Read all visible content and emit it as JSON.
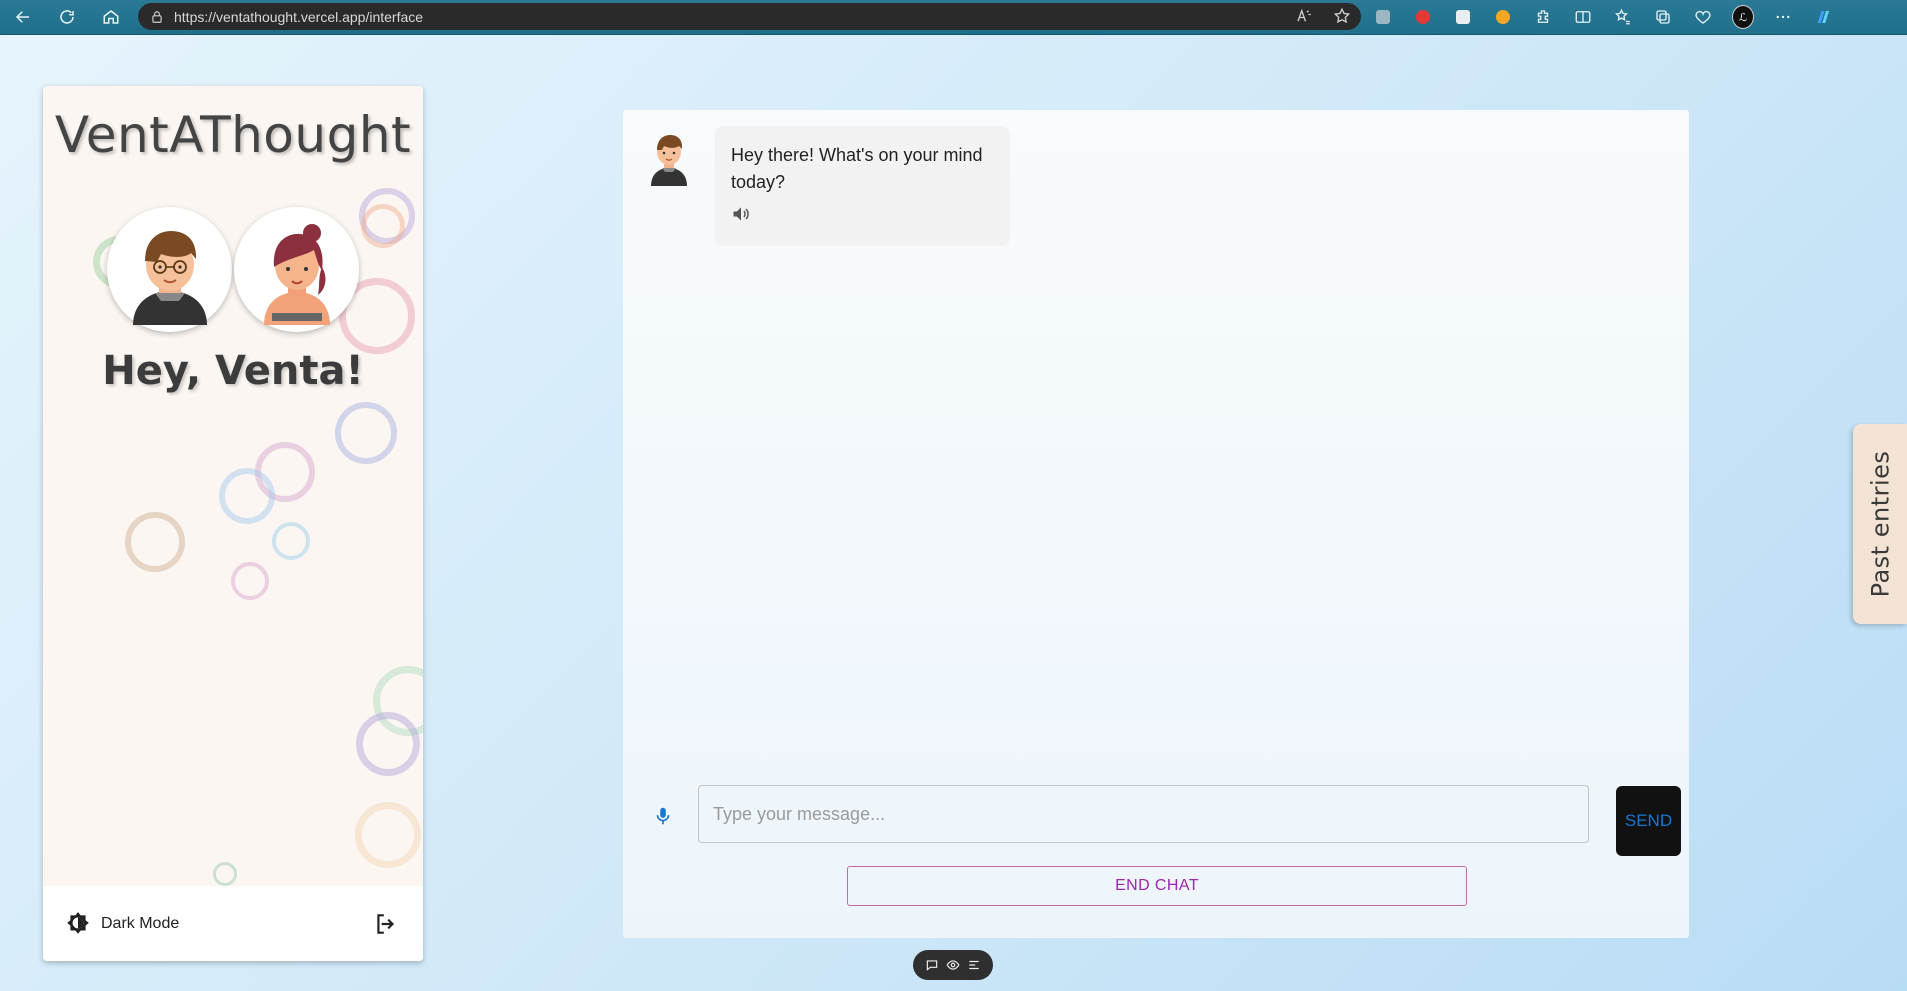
{
  "browser": {
    "url": "https://ventathought.vercel.app/interface",
    "profile_initial": "ℒ"
  },
  "sidebar": {
    "app_title": "VentAThought",
    "greeting": "Hey, Venta!",
    "dark_mode_label": "Dark Mode",
    "avatars": [
      "boy-avatar",
      "girl-avatar"
    ]
  },
  "chat": {
    "messages": [
      {
        "sender": "bot",
        "text": "Hey there! What's on your mind today?"
      }
    ],
    "input": {
      "placeholder": "Type your message...",
      "value": ""
    },
    "send_label": "SEND",
    "end_chat_label": "END CHAT"
  },
  "past_entries": {
    "label": "Past entries"
  },
  "colors": {
    "browser_bar": "#1f6f8b",
    "sidebar_bg": "#fbf6f2",
    "send_text": "#1976d2",
    "end_chat_text": "#9c27b0",
    "past_entries_bg": "#f3e3d4"
  }
}
